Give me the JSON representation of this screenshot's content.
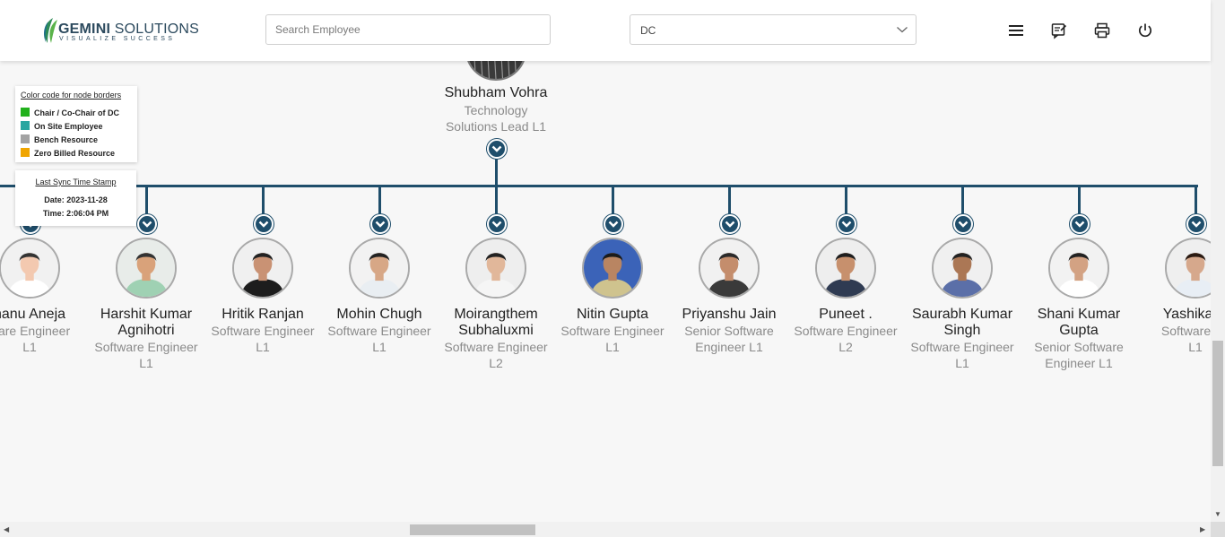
{
  "header": {
    "logo_name_bold": "GEMINI",
    "logo_name_rest": " SOLUTIONS",
    "logo_tagline": "VISUALIZE SUCCESS",
    "search_placeholder": "Search Employee",
    "dc_select_value": "DC",
    "icons": [
      "menu-icon",
      "feedback-icon",
      "print-icon",
      "power-icon"
    ]
  },
  "root": {
    "name": "Shubham Vohra",
    "title_line1": "Technology",
    "title_line2": "Solutions Lead L1"
  },
  "legend": {
    "title": "Color code for node borders",
    "items": [
      {
        "label": "Chair / Co-Chair of DC",
        "color": "#22b11c"
      },
      {
        "label": "On Site Employee",
        "color": "#2aa6a0"
      },
      {
        "label": "Bench Resource",
        "color": "#a3a3a3"
      },
      {
        "label": "Zero Billed Resource",
        "color": "#f0a500"
      }
    ]
  },
  "sync": {
    "title": "Last Sync Time Stamp",
    "date": "Date: 2023-11-28",
    "time": "Time: 2:06:04 PM"
  },
  "employees": [
    {
      "name": [
        "hanu Aneja"
      ],
      "title": [
        "ware Engineer",
        "L1"
      ]
    },
    {
      "name": [
        "Harshit Kumar",
        "Agnihotri"
      ],
      "title": [
        "Software Engineer",
        "L1"
      ]
    },
    {
      "name": [
        "Hritik Ranjan"
      ],
      "title": [
        "Software Engineer",
        "L1"
      ]
    },
    {
      "name": [
        "Mohin Chugh"
      ],
      "title": [
        "Software Engineer",
        "L1"
      ]
    },
    {
      "name": [
        "Moirangthem",
        "Subhaluxmi"
      ],
      "title": [
        "Software Engineer",
        "L2"
      ]
    },
    {
      "name": [
        "Nitin Gupta"
      ],
      "title": [
        "Software Engineer",
        "L1"
      ]
    },
    {
      "name": [
        "Priyanshu Jain"
      ],
      "title": [
        "Senior Software",
        "Engineer L1"
      ]
    },
    {
      "name": [
        "Puneet ."
      ],
      "title": [
        "Software Engineer",
        "L2"
      ]
    },
    {
      "name": [
        "Saurabh Kumar",
        "Singh"
      ],
      "title": [
        "Software Engineer",
        "L1"
      ]
    },
    {
      "name": [
        "Shani Kumar",
        "Gupta"
      ],
      "title": [
        "Senior Software",
        "Engineer L1"
      ]
    },
    {
      "name": [
        "Yashika G"
      ],
      "title": [
        "Software En",
        "L1"
      ]
    }
  ],
  "colors": {
    "connector": "#1f4e6b",
    "avatar_border": "#a9a9a9",
    "title_text": "#8a8a8a"
  }
}
